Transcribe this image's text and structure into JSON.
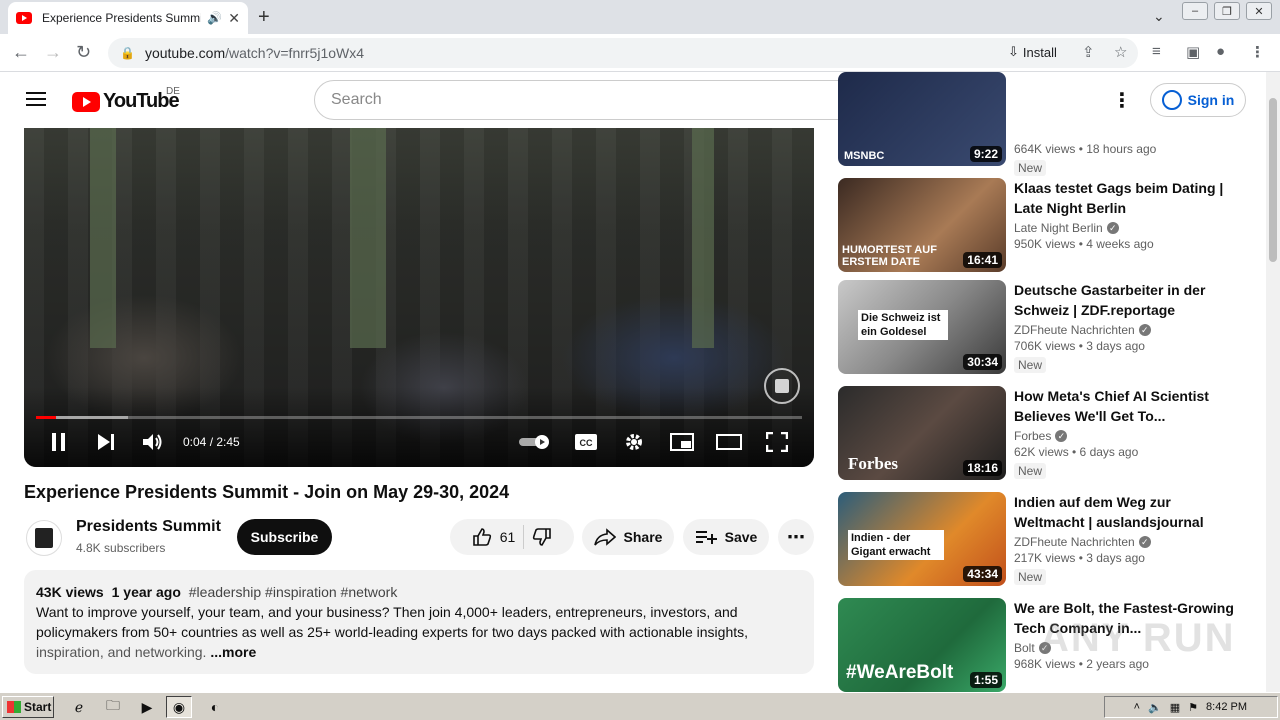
{
  "browser": {
    "tab_title": "Experience Presidents Summit -",
    "url_host": "youtube.com",
    "url_path": "/watch?v=fnrr5j1oWx4",
    "install_label": "Install"
  },
  "youtube": {
    "logo_text": "YouTube",
    "country_code": "DE",
    "search_placeholder": "Search",
    "signin_label": "Sign in"
  },
  "player": {
    "time": "0:04 / 2:45",
    "progress_fraction": 0.026,
    "buffered_fraction": 0.12
  },
  "video": {
    "title": "Experience Presidents Summit - Join on May 29-30, 2024",
    "channel": "Presidents Summit",
    "subscribers": "4.8K subscribers",
    "subscribe_label": "Subscribe",
    "likes": "61",
    "share_label": "Share",
    "save_label": "Save",
    "views": "43K views",
    "age": "1 year ago",
    "tags": "#leadership #inspiration #network",
    "description_l1": "Want to improve yourself, your team, and your business? Then join 4,000+ leaders, entrepreneurs, investors, and",
    "description_l2": "policymakers from 50+ countries as well as 25+ world-leading experts for two days packed with actionable insights,",
    "description_l3": "inspiration, and networking.",
    "more_label": "...more"
  },
  "recommendations": [
    {
      "title": "",
      "channel": "",
      "stats": "664K views • 18 hours ago",
      "duration": "9:22",
      "badge": "New",
      "thumb_text": "MSNBC"
    },
    {
      "title": "Klaas testet Gags beim Dating | Late Night Berlin",
      "channel": "Late Night Berlin",
      "stats": "950K views • 4 weeks ago",
      "duration": "16:41",
      "badge": "",
      "thumb_text": "HUMORTEST AUF ERSTEM DATE"
    },
    {
      "title": "Deutsche Gastarbeiter in der Schweiz | ZDF.reportage",
      "channel": "ZDFheute Nachrichten",
      "stats": "706K views • 3 days ago",
      "duration": "30:34",
      "badge": "New",
      "thumb_text": "Die Schweiz ist ein Goldesel"
    },
    {
      "title": "How Meta's Chief AI Scientist Believes We'll Get To...",
      "channel": "Forbes",
      "stats": "62K views • 6 days ago",
      "duration": "18:16",
      "badge": "New",
      "thumb_text": "Forbes"
    },
    {
      "title": "Indien auf dem Weg zur Weltmacht | auslandsjournal",
      "channel": "ZDFheute Nachrichten",
      "stats": "217K views • 3 days ago",
      "duration": "43:34",
      "badge": "New",
      "thumb_text": "Indien - der Gigant erwacht"
    },
    {
      "title": "We are Bolt, the Fastest-Growing Tech Company in...",
      "channel": "Bolt",
      "stats": "968K views • 2 years ago",
      "duration": "1:55",
      "badge": "",
      "thumb_text": "#WeAreBolt"
    }
  ],
  "watermark_text": "ANY RUN",
  "taskbar": {
    "start_label": "Start",
    "clock": "8:42 PM"
  },
  "colors": {
    "youtube_red": "#ff0000",
    "link_blue": "#065fd4"
  }
}
